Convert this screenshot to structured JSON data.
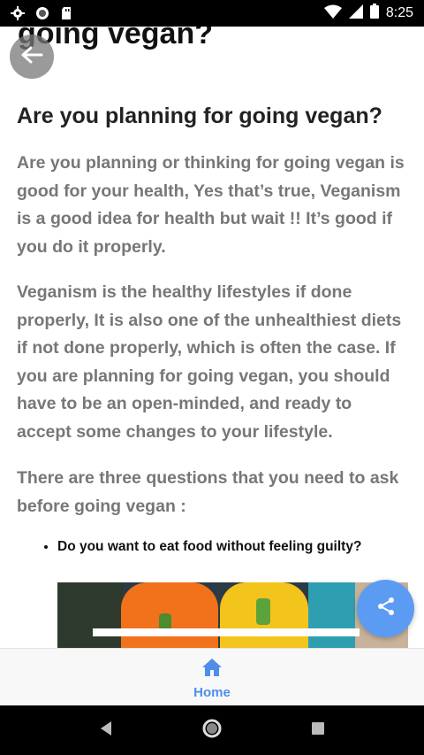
{
  "status_bar": {
    "time": "8:25"
  },
  "page": {
    "title": "going vegan?"
  },
  "article": {
    "heading": "Are you planning for going vegan?",
    "paragraphs": [
      "Are you planning or thinking for going vegan is good for your health, Yes that’s true, Veganism is a good idea for health but wait !! It’s good if you do it properly.",
      "Veganism is the healthy lifestyles if done properly, It is also one of the unhealthiest diets if not done properly, which is often the case. If you are planning for going vegan, you should have to be an open-minded, and ready to accept some changes to your lifestyle.",
      "There are three questions that you need to ask before going vegan :"
    ],
    "bullets": [
      "Do you want to eat food without feeling guilty?"
    ]
  },
  "bottom_nav": {
    "home_label": "Home"
  },
  "colors": {
    "accent": "#4f8ee8",
    "fab": "#5b9cf2",
    "body_text": "#777777"
  },
  "icons": {
    "back": "arrow-left-icon",
    "share": "share-icon",
    "home": "home-icon"
  }
}
